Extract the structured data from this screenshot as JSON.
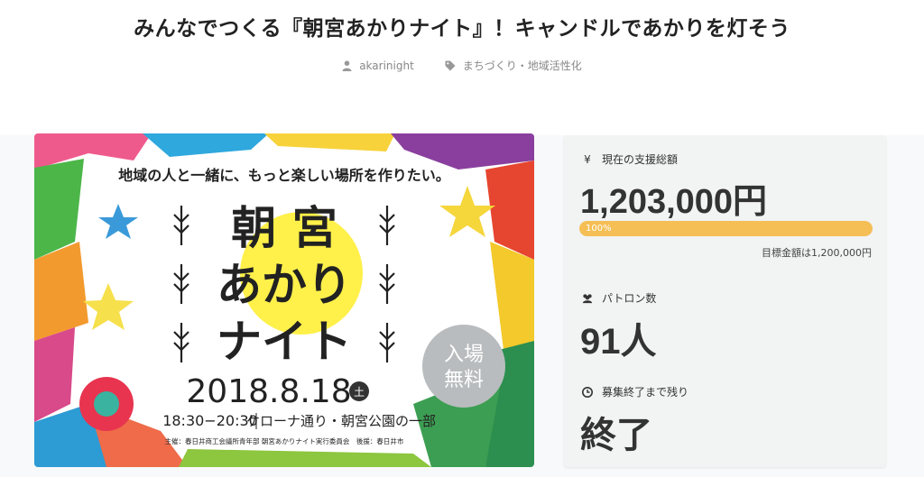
{
  "page": {
    "title": "みんなでつくる『朝宮あかりナイト』！キャンドルであかりを灯そう",
    "author": "akarinight",
    "author_icon": "user-icon",
    "category": "まちづくり・地域活性化",
    "category_icon": "tag-icon"
  },
  "hero": {
    "tagline": "地域の人と一緒に、もっと楽しい場所を作りたい。",
    "title_line1": "朝 宮",
    "title_line2": "あかり",
    "title_line3": "ナイト",
    "date": "2018.8.18",
    "weekday": "土",
    "badge_line1": "入場",
    "badge_line2": "無料",
    "time": "18:30−20:30",
    "venue": "ケローナ通り・朝宮公園の一部",
    "organizer": "主催：春日井商工会議所青年部 朝宮あかりナイト実行委員会　後援：春日井市"
  },
  "funding": {
    "total_icon": "yen-icon",
    "total_label": "現在の支援総額",
    "total_amount": "1,203,000円",
    "progress_percent": 100,
    "progress_label": "100%",
    "goal_text": "目標金額は1,200,000円",
    "patron_icon": "users-icon",
    "patron_label": "パトロン数",
    "patron_count": "91人",
    "time_icon": "clock-icon",
    "time_label": "募集終了まで残り",
    "time_value": "終了"
  },
  "colors": {
    "accent": "#f5bf55",
    "sun": "#fff04a",
    "badge": "#b9bcbe"
  }
}
